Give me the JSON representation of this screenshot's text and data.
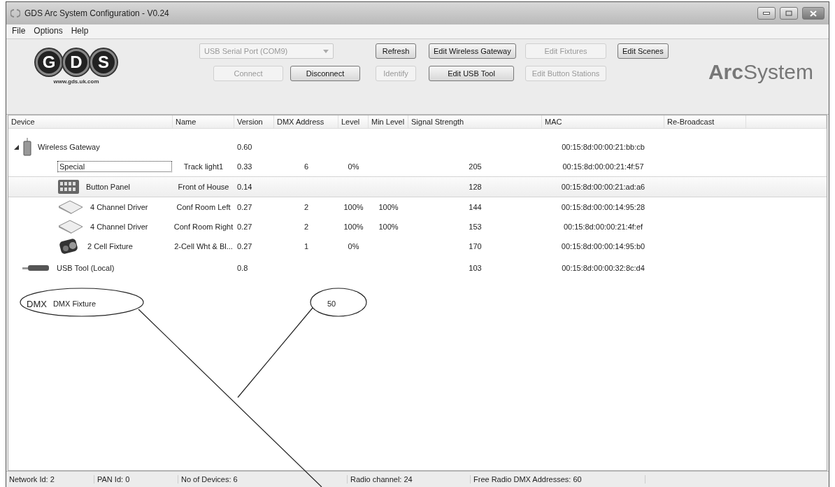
{
  "window": {
    "title": "GDS Arc System Configuration - V0.24"
  },
  "menu": [
    "File",
    "Options",
    "Help"
  ],
  "logo": {
    "letters": [
      "G",
      "D",
      "S"
    ],
    "url": "www.gds.uk.com"
  },
  "port": {
    "value": "USB Serial Port (COM9)",
    "disabled": true
  },
  "button_rows": [
    [
      {
        "label": "Refresh",
        "disabled": false
      },
      {
        "label": "Edit Wireless Gateway",
        "disabled": false
      },
      {
        "label": "Edit Fixtures",
        "disabled": true
      },
      {
        "label": "Edit Scenes",
        "disabled": false
      }
    ],
    [
      {
        "label": "Connect",
        "disabled": true
      },
      {
        "label": "Disconnect",
        "disabled": false
      },
      {
        "label": "Identify",
        "disabled": true
      },
      {
        "label": "Edit USB Tool",
        "disabled": false
      },
      {
        "label": "Edit Button Stations",
        "disabled": true
      }
    ]
  ],
  "brand": {
    "bold": "Arc",
    "light": "System"
  },
  "table": {
    "columns": [
      "Device",
      "Name",
      "Version",
      "DMX Address",
      "Level",
      "Min Level",
      "Signal Strength",
      "MAC",
      "Re-Broadcast"
    ],
    "rows": [
      {
        "kind": "gateway",
        "device": "Wireless Gateway",
        "version": "0.60",
        "mac": "00:15:8d:00:00:21:bb:cb",
        "expanded": true,
        "selected": false,
        "focused": false,
        "children": [
          {
            "kind": "plain",
            "device": "Special",
            "name": "Track light1",
            "version": "0.33",
            "dmx_address": "6",
            "level": "0%",
            "signal_strength": "205",
            "mac": "00:15:8d:00:00:21:4f:57",
            "selected": false,
            "focused": true
          },
          {
            "kind": "panel",
            "device": "Button Panel",
            "name": "Front of House",
            "version": "0.14",
            "signal_strength": "128",
            "mac": "00:15:8d:00:00:21:ad:a6",
            "selected": true,
            "focused": false
          },
          {
            "kind": "driver",
            "device": "4 Channel Driver",
            "name": "Conf Room Left",
            "version": "0.27",
            "dmx_address": "2",
            "level": "100%",
            "min_level": "100%",
            "signal_strength": "144",
            "mac": "00:15:8d:00:00:14:95:28",
            "selected": false,
            "focused": false
          },
          {
            "kind": "driver",
            "device": "4 Channel Driver",
            "name": "Conf Room Right",
            "version": "0.27",
            "dmx_address": "2",
            "level": "100%",
            "min_level": "100%",
            "signal_strength": "153",
            "mac": "00:15:8d:00:00:21:4f:ef",
            "selected": false,
            "focused": false
          },
          {
            "kind": "fixture",
            "device": "2 Cell Fixture",
            "name": "2-Cell Wht & Bl...",
            "version": "0.27",
            "dmx_address": "1",
            "level": "0%",
            "signal_strength": "170",
            "mac": "00:15:8d:00:00:14:95:b0",
            "selected": false,
            "focused": false
          }
        ]
      },
      {
        "kind": "usb",
        "device": "USB Tool (Local)",
        "version": "0.8",
        "signal_strength": "103",
        "mac": "00:15:8d:00:00:32:8c:d4",
        "selected": false,
        "focused": false
      },
      {
        "kind": "dmx",
        "tag": "DMX",
        "device": "DMX Fixture",
        "dmx_address": "50",
        "selected": false,
        "focused": false
      }
    ]
  },
  "status_bar": [
    "Network Id: 2",
    "PAN Id: 0",
    "No of Devices: 6",
    "Radio channel: 24",
    "Free Radio DMX Addresses: 60"
  ]
}
